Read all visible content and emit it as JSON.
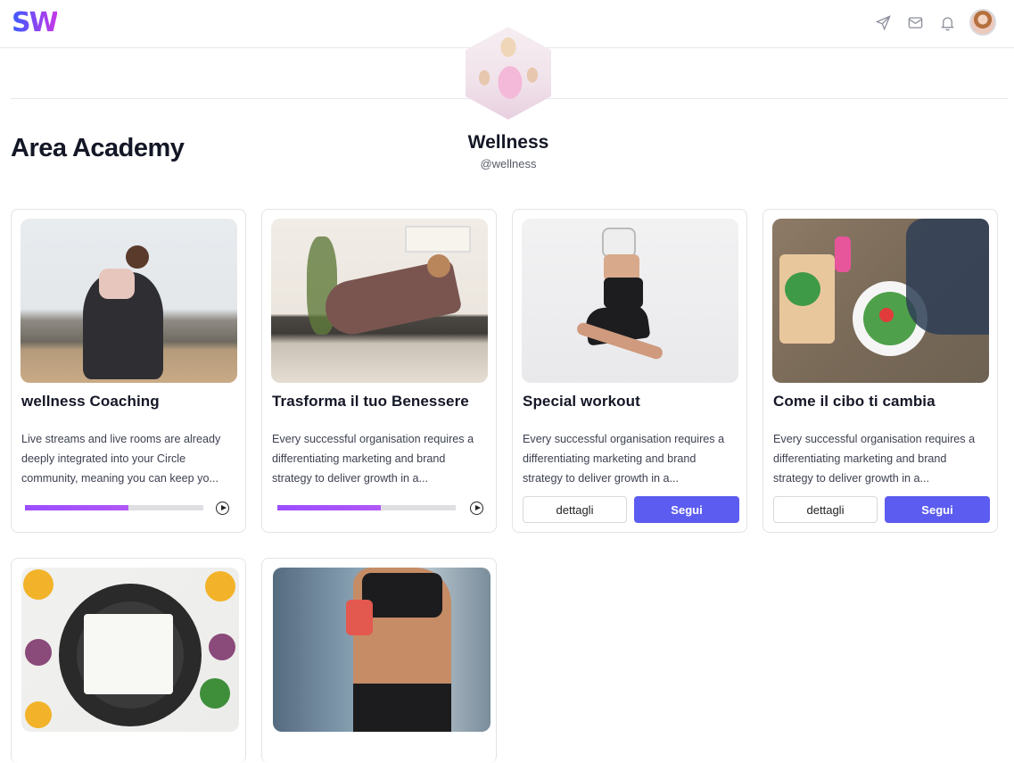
{
  "brand": {
    "logo_text": "SW"
  },
  "header": {
    "icons": [
      "send-icon",
      "mail-icon",
      "bell-icon"
    ],
    "avatar_label": "user-avatar"
  },
  "profile": {
    "name": "Wellness",
    "handle": "@wellness"
  },
  "page": {
    "title": "Area Academy"
  },
  "courses": [
    {
      "title": "wellness Coaching",
      "description": "Live streams and live rooms are already deeply integrated into your Circle community, meaning you can keep yo...",
      "progress": 0.58,
      "kind": "progress"
    },
    {
      "title": "Trasforma il tuo Benessere",
      "description": "Every successful organisation requires a differentiating marketing and brand strategy to deliver growth in a...",
      "progress": 0.58,
      "kind": "progress"
    },
    {
      "title": "Special workout",
      "description": "Every successful organisation requires a differentiating marketing and brand strategy to deliver growth in a...",
      "details_label": "dettagli",
      "follow_label": "Segui",
      "kind": "buttons"
    },
    {
      "title": "Come il cibo ti cambia",
      "description": "Every successful organisation requires a differentiating marketing and brand strategy to deliver growth in a...",
      "details_label": "dettagli",
      "follow_label": "Segui",
      "kind": "buttons"
    }
  ],
  "colors": {
    "accent": "#5c5cf0",
    "progress": "#9b4dff",
    "brand_start": "#3b5bff",
    "brand_end": "#c637e8"
  }
}
